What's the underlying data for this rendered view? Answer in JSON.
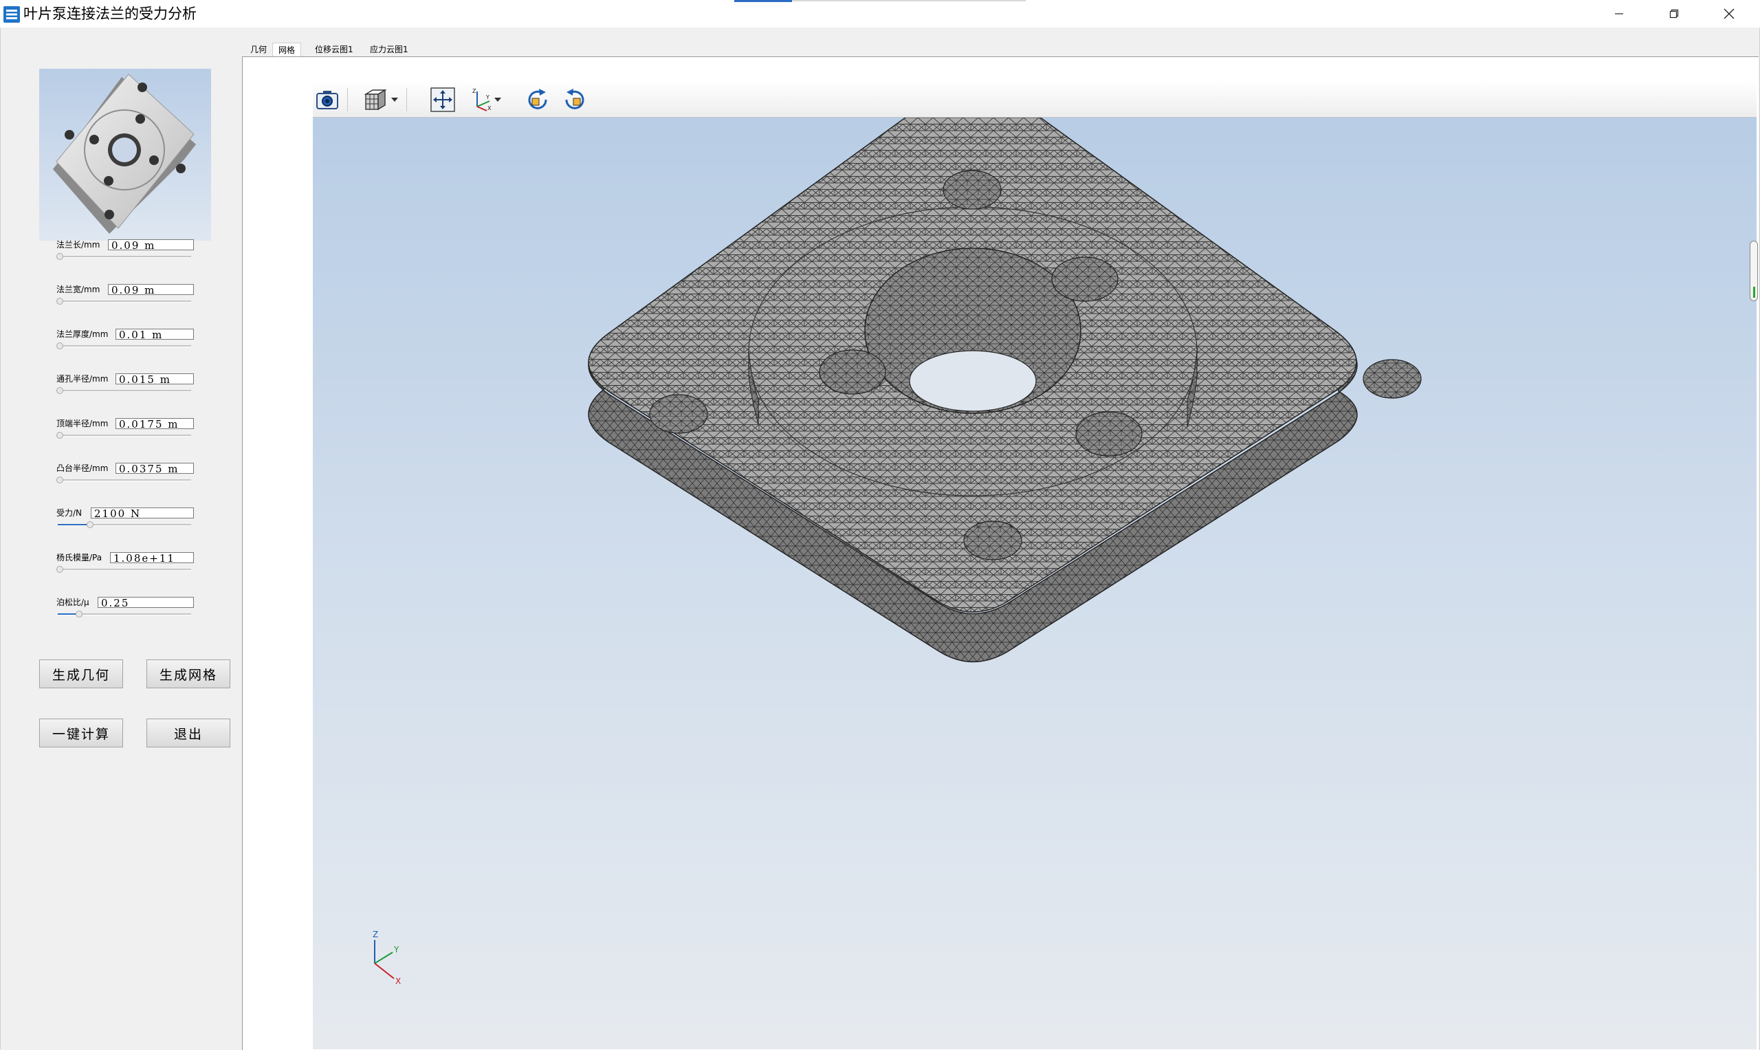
{
  "window": {
    "title": "叶片泵连接法兰的受力分析",
    "controls": {
      "minimize": "minimize-icon",
      "restore": "restore-icon",
      "close": "close-icon"
    }
  },
  "tabs": [
    {
      "label": "几何",
      "active": false
    },
    {
      "label": "网格",
      "active": true
    },
    {
      "label": "位移云图1",
      "active": false
    },
    {
      "label": "应力云图1",
      "active": false
    }
  ],
  "params": [
    {
      "label": "法兰长/mm",
      "value": "0.09 m",
      "slider": 0.0
    },
    {
      "label": "法兰宽/mm",
      "value": "0.09 m",
      "slider": 0.0
    },
    {
      "label": "法兰厚度/mm",
      "value": "0.01 m",
      "slider": 0.0
    },
    {
      "label": "通孔半径/mm",
      "value": "0.015 m",
      "slider": 0.0
    },
    {
      "label": "顶端半径/mm",
      "value": "0.0175 m",
      "slider": 0.0
    },
    {
      "label": "凸台半径/mm",
      "value": "0.0375 m",
      "slider": 0.0
    },
    {
      "label": "受力/N",
      "value": "2100 N",
      "slider": 0.15
    },
    {
      "label": "杨氏模量/Pa",
      "value": "1.08e+11",
      "slider": 0.0
    },
    {
      "label": "泊松比/μ",
      "value": "0.25",
      "slider": 0.1
    }
  ],
  "buttons": {
    "generate_geometry": "生成几何",
    "generate_mesh": "生成网格",
    "compute": "一键计算",
    "exit": "退出"
  },
  "toolbar": [
    "camera-icon",
    "view-cube-icon",
    "fit-view-icon",
    "axis-orient-icon",
    "rotate-cw-icon",
    "rotate-ccw-icon"
  ],
  "triad": {
    "x": "X",
    "y": "Y",
    "z": "Z"
  },
  "colors": {
    "accent": "#2b6cc4",
    "viewport_top": "#b8cde5",
    "viewport_bottom": "#e6eaef",
    "mesh_fill": "#a9a9a9",
    "mesh_edge": "#2e2e2e"
  }
}
